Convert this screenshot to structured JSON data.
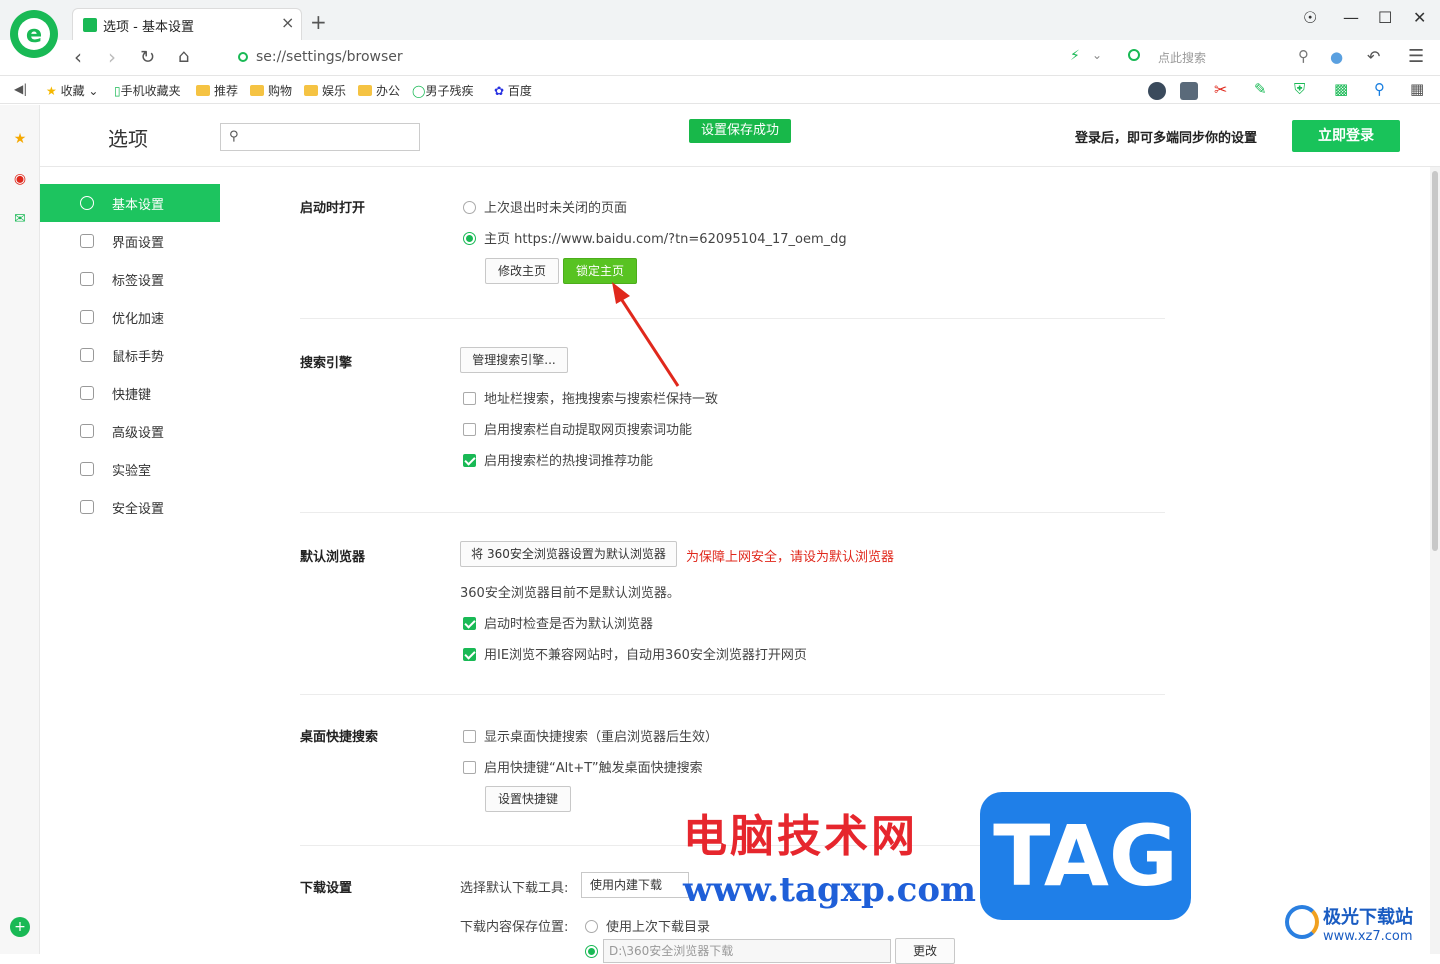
{
  "window": {
    "tab_title": "选项 - 基本设置",
    "new_tab_label": "+",
    "url": "se://settings/browser",
    "search_placeholder": "点此搜索"
  },
  "bookmarks": [
    {
      "label": "收藏",
      "icon": "star-icon"
    },
    {
      "label": "手机收藏夹",
      "icon": "phone-icon"
    },
    {
      "label": "推荐",
      "icon": "folder-icon"
    },
    {
      "label": "购物",
      "icon": "folder-icon"
    },
    {
      "label": "娱乐",
      "icon": "folder-icon"
    },
    {
      "label": "办公",
      "icon": "folder-icon"
    },
    {
      "label": "男子残疾",
      "icon": "search-icon"
    },
    {
      "label": "百度",
      "icon": "baidu-icon"
    }
  ],
  "header": {
    "title": "选项",
    "search_placeholder": "",
    "saved_toast": "设置保存成功",
    "login_hint": "登录后，即可多端同步你的设置",
    "login_button": "立即登录"
  },
  "sidenav": [
    {
      "label": "基本设置",
      "active": true
    },
    {
      "label": "界面设置",
      "active": false
    },
    {
      "label": "标签设置",
      "active": false
    },
    {
      "label": "优化加速",
      "active": false
    },
    {
      "label": "鼠标手势",
      "active": false
    },
    {
      "label": "快捷键",
      "active": false
    },
    {
      "label": "高级设置",
      "active": false
    },
    {
      "label": "实验室",
      "active": false
    },
    {
      "label": "安全设置",
      "active": false
    }
  ],
  "startup": {
    "title": "启动时打开",
    "option_last": "上次退出时未关闭的页面",
    "option_home": "主页 https://www.baidu.com/?tn=62095104_17_oem_dg",
    "selected": "home",
    "btn_modify": "修改主页",
    "btn_lock": "锁定主页"
  },
  "search": {
    "title": "搜索引擎",
    "btn_manage": "管理搜索引擎...",
    "opt1": {
      "label": "地址栏搜索，拖拽搜索与搜索栏保持一致",
      "checked": false
    },
    "opt2": {
      "label": "启用搜索栏自动提取网页搜索词功能",
      "checked": false
    },
    "opt3": {
      "label": "启用搜索栏的热搜词推荐功能",
      "checked": true
    }
  },
  "default_browser": {
    "title": "默认浏览器",
    "btn_set": "将 360安全浏览器设置为默认浏览器",
    "warning": "为保障上网安全，请设为默认浏览器",
    "status": "360安全浏览器目前不是默认浏览器。",
    "opt1": {
      "label": "启动时检查是否为默认浏览器",
      "checked": true
    },
    "opt2": {
      "label": "用IE浏览不兼容网站时，自动用360安全浏览器打开网页",
      "checked": true
    }
  },
  "desktop_search": {
    "title": "桌面快捷搜索",
    "opt1": {
      "label": "显示桌面快捷搜索（重启浏览器后生效）",
      "checked": false
    },
    "opt2": {
      "label": "启用快捷键“Alt+T”触发桌面快捷搜索",
      "checked": false
    },
    "btn_shortcut": "设置快捷键"
  },
  "download": {
    "title": "下载设置",
    "tool_label": "选择默认下载工具:",
    "tool_value": "使用内建下载",
    "location_label": "下载内容保存位置:",
    "opt_last": "使用上次下载目录",
    "path_value": "D:\\360安全浏览器下载",
    "btn_change": "更改"
  },
  "watermark": {
    "cn": "电脑技术网",
    "url": "www.tagxp.com",
    "tag": "TAG",
    "site_name": "极光下载站",
    "site_url": "www.xz7.com"
  },
  "colors": {
    "brand_green": "#19b955",
    "active_nav": "#1dc45f",
    "warning_red": "#e0281c"
  }
}
